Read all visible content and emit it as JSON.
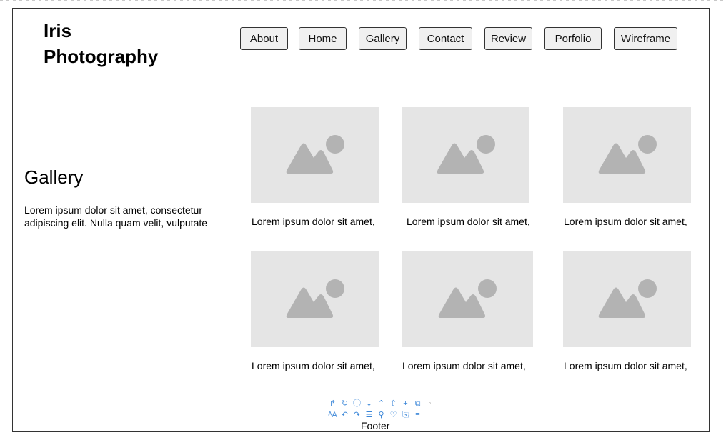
{
  "header": {
    "logo_line1": "Iris",
    "logo_line2": "Photography",
    "nav": [
      "About",
      "Home",
      "Gallery",
      "Contact",
      "Review",
      "Porfolio",
      "Wireframe"
    ]
  },
  "gallery": {
    "title": "Gallery",
    "description": "Lorem ipsum dolor sit amet, consectetur adipiscing elit. Nulla quam velit, vulputate",
    "items": [
      {
        "caption": "Lorem ipsum dolor sit amet,"
      },
      {
        "caption": "Lorem ipsum dolor sit amet,"
      },
      {
        "caption": "Lorem ipsum dolor sit amet,"
      },
      {
        "caption": "Lorem ipsum dolor sit amet,"
      },
      {
        "caption": "Lorem ipsum dolor sit amet,"
      },
      {
        "caption": "Lorem ipsum dolor sit amet,"
      }
    ]
  },
  "toolbar_icons": [
    "redirect-arrow-icon",
    "refresh-icon",
    "info-icon",
    "chevron-down-icon",
    "chevron-up-icon",
    "share-icon",
    "plus-icon",
    "external-icon",
    "dot-icon",
    "text-size-icon",
    "undo-icon",
    "redo-icon",
    "list-icon",
    "search-icon",
    "heart-icon",
    "copy-icon",
    "menu-icon"
  ],
  "footer": {
    "label": "Footer"
  },
  "colors": {
    "placeholder_bg": "#e5e5e5",
    "placeholder_icon": "#b3b3b3",
    "toolbar_icon": "#3a86d8"
  }
}
